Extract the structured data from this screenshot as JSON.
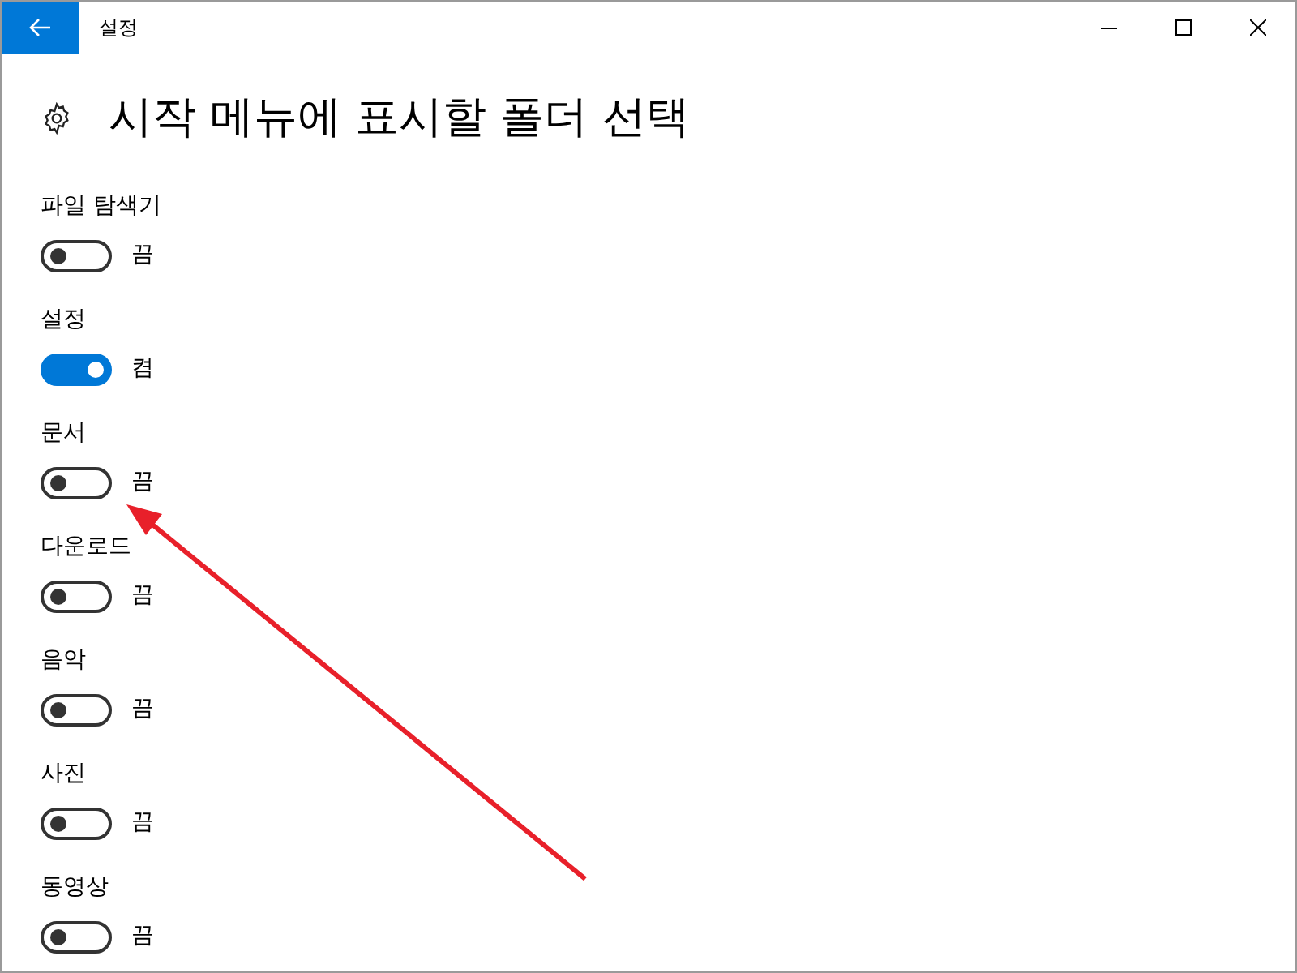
{
  "window": {
    "title": "설정"
  },
  "page": {
    "title": "시작 메뉴에 표시할 폴더 선택"
  },
  "folders": [
    {
      "label": "파일 탐색기",
      "on": false,
      "state": "끔"
    },
    {
      "label": "설정",
      "on": true,
      "state": "켬"
    },
    {
      "label": "문서",
      "on": false,
      "state": "끔"
    },
    {
      "label": "다운로드",
      "on": false,
      "state": "끔"
    },
    {
      "label": "음악",
      "on": false,
      "state": "끔"
    },
    {
      "label": "사진",
      "on": false,
      "state": "끔"
    },
    {
      "label": "동영상",
      "on": false,
      "state": "끔"
    }
  ]
}
